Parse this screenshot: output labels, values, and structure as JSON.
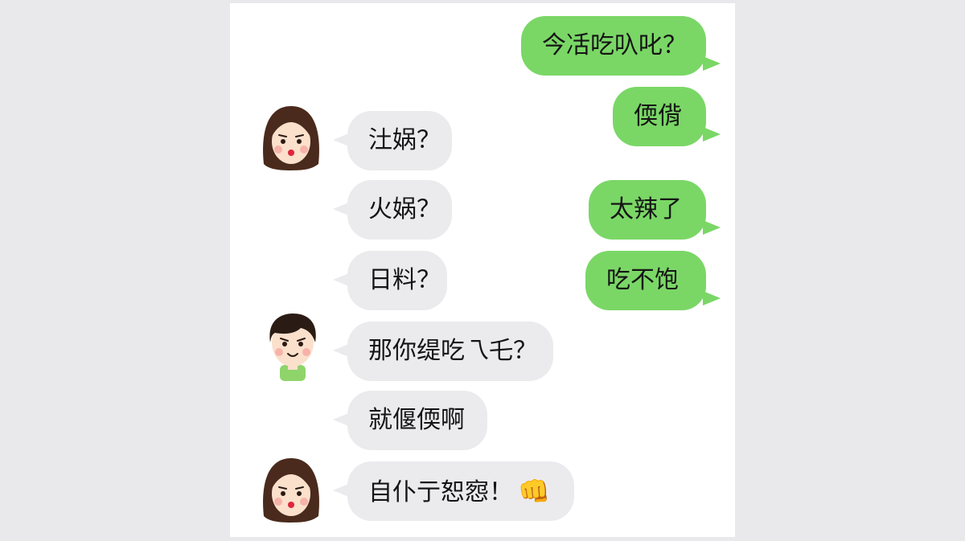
{
  "messages": [
    {
      "side": "me",
      "text": "今㓉吃叺叱？"
    },
    {
      "side": "me",
      "text": "偄偝"
    },
    {
      "side": "them",
      "avatar": "girl-avatar",
      "text": "汢娲？"
    },
    {
      "side": "them",
      "text": "火娲？"
    },
    {
      "side": "me",
      "text": "太辣了"
    },
    {
      "side": "them",
      "text": "日料？"
    },
    {
      "side": "me",
      "text": "吃不饱"
    },
    {
      "side": "them",
      "avatar": "boy-avatar",
      "text": "那你缇吃乁乇？"
    },
    {
      "side": "them",
      "text": "就偃偄啊"
    },
    {
      "side": "them",
      "avatar": "girl-avatar",
      "text": "自仆亍恕惌！",
      "emoji": "fist-icon",
      "emoji_char": "👊"
    }
  ],
  "colors": {
    "background": "#e9e9ec",
    "panel": "#ffffff",
    "bubble_me": "#7ad766",
    "bubble_them": "#ebebee"
  }
}
